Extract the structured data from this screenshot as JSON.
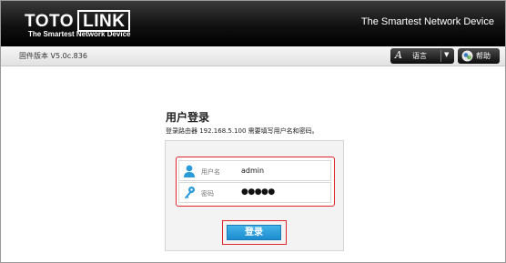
{
  "header": {
    "logo_left": "TOTO",
    "logo_right": "LINK",
    "logo_tagline": "The Smartest Network Device",
    "slogan": "The Smartest Network Device"
  },
  "toolbar": {
    "firmware_label": "固件版本 V5.0c.836",
    "language_label": "语言",
    "help_label": "帮助",
    "language_icon_glyph": "A"
  },
  "login": {
    "title": "用户登录",
    "hint": "登录路由器 192.168.5.100 需要填写用户名和密码。",
    "username_label": "用户名",
    "username_value": "admin",
    "password_label": "密码",
    "password_value": "●●●●●",
    "submit_label": "登录"
  },
  "colors": {
    "accent_blue": "#2a9ad8",
    "highlight_red": "#e0262b",
    "header_black": "#000000"
  }
}
